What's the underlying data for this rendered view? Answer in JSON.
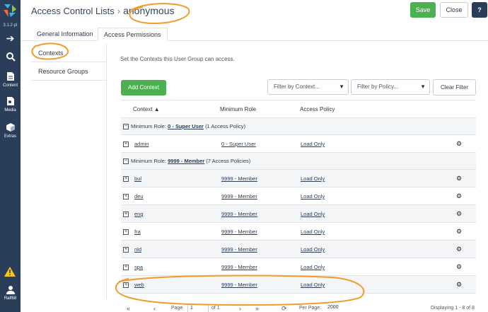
{
  "app": {
    "version": "3.1.2-pl",
    "rail": [
      {
        "icon": "arrow-right-icon",
        "label": ""
      },
      {
        "icon": "search-icon",
        "label": ""
      },
      {
        "icon": "content-icon",
        "label": "Content"
      },
      {
        "icon": "media-icon",
        "label": "Media"
      },
      {
        "icon": "extras-icon",
        "label": "Extras"
      }
    ],
    "user": {
      "name": "Ralf68",
      "icon": "user-icon"
    },
    "warning_icon": "warning-icon",
    "brand_color": "#2b3e59",
    "accent_color": "#4caf50",
    "highlight_color": "#f39a2c"
  },
  "header": {
    "breadcrumb_parent": "Access Control Lists",
    "breadcrumb_separator": "›",
    "breadcrumb_current": "anonymous",
    "save_label": "Save",
    "close_label": "Close",
    "help_label": "?"
  },
  "tabs": [
    {
      "label": "General Information",
      "active": false
    },
    {
      "label": "Access Permissions",
      "active": true
    }
  ],
  "subtabs": [
    {
      "label": "Contexts",
      "active": true
    },
    {
      "label": "Resource Groups",
      "active": false
    }
  ],
  "panel": {
    "description": "Set the Contexts this User Group can access.",
    "add_button": "Add Context",
    "filter_context": "Filter by Context...",
    "filter_policy": "Filter by Policy...",
    "clear_button": "Clear Filter"
  },
  "grid": {
    "columns": [
      "Context ▲",
      "Minimum Role",
      "Access Policy"
    ],
    "groups": [
      {
        "label_prefix": "Minimum Role:",
        "role": "0 - Super User",
        "count": "(1 Access Policy)",
        "rows": [
          {
            "context": "admin",
            "role": "0 - Super User",
            "policy": "Load Only"
          }
        ]
      },
      {
        "label_prefix": "Minimum Role:",
        "role": "9999 - Member",
        "count": "(7 Access Policies)",
        "rows": [
          {
            "context": "bul",
            "role": "9999 - Member",
            "policy": "Load Only"
          },
          {
            "context": "deu",
            "role": "9999 - Member",
            "policy": "Load Only"
          },
          {
            "context": "eng",
            "role": "9999 - Member",
            "policy": "Load Only"
          },
          {
            "context": "fra",
            "role": "9999 - Member",
            "policy": "Load Only"
          },
          {
            "context": "nld",
            "role": "9999 - Member",
            "policy": "Load Only"
          },
          {
            "context": "spa",
            "role": "9999 - Member",
            "policy": "Load Only"
          },
          {
            "context": "web",
            "role": "9999 - Member",
            "policy": "Load Only"
          }
        ]
      }
    ]
  },
  "paging": {
    "page_label": "Page",
    "page_value": "1",
    "of_label": "of 1",
    "per_page_label": "Per Page:",
    "per_page_value": "2000",
    "displaying": "Displaying 1 - 8 of 8"
  }
}
